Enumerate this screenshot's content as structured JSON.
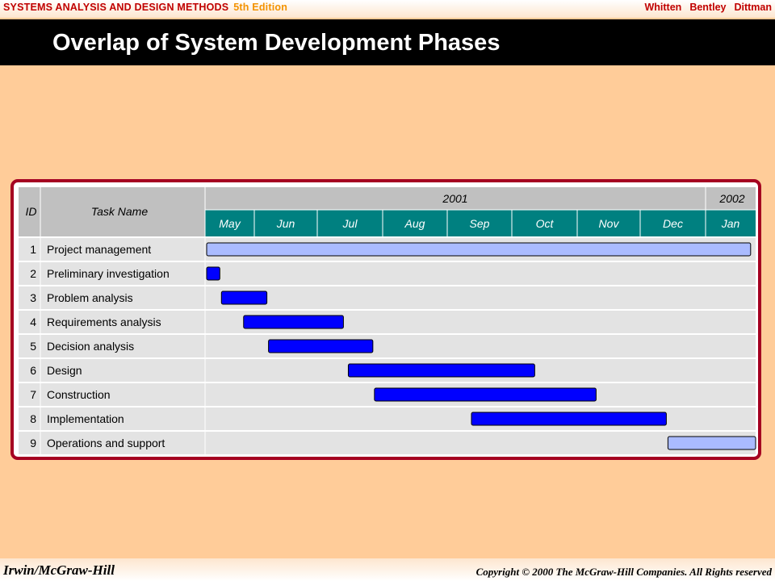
{
  "header": {
    "book_title": "SYSTEMS ANALYSIS AND DESIGN METHODS",
    "edition": "5th Edition",
    "authors": [
      "Whitten",
      "Bentley",
      "Dittman"
    ]
  },
  "slide": {
    "title": "Overlap of System Development Phases"
  },
  "footer": {
    "publisher": "Irwin/McGraw-Hill",
    "copyright": "Copyright © 2000 The McGraw-Hill Companies. All Rights reserved"
  },
  "colors": {
    "background": "#ffcc99",
    "title_bar": "#000000",
    "frame_border": "#a50021",
    "header_gray": "#c0c0c0",
    "month_teal": "#008080",
    "row_gray": "#e3e3e3",
    "bar_dark": "#0000ff",
    "bar_light": "#aabbff"
  },
  "chart_data": {
    "type": "gantt",
    "headers": {
      "id": "ID",
      "task_name": "Task Name"
    },
    "years": [
      {
        "label": "2001",
        "start": 0,
        "end": 8
      },
      {
        "label": "2002",
        "start": 8,
        "end": 9
      }
    ],
    "months": [
      "May",
      "Jun",
      "Jul",
      "Aug",
      "Sep",
      "Oct",
      "Nov",
      "Dec",
      "Jan"
    ],
    "tasks": [
      {
        "id": "1",
        "name": "Project management",
        "start": 0.0,
        "end": 8.9,
        "style": "light"
      },
      {
        "id": "2",
        "name": "Preliminary investigation",
        "start": 0.0,
        "end": 0.3,
        "style": "dark"
      },
      {
        "id": "3",
        "name": "Problem analysis",
        "start": 0.3,
        "end": 1.2,
        "style": "dark"
      },
      {
        "id": "4",
        "name": "Requirements analysis",
        "start": 0.75,
        "end": 2.4,
        "style": "dark"
      },
      {
        "id": "5",
        "name": "Decision analysis",
        "start": 1.2,
        "end": 2.85,
        "style": "dark"
      },
      {
        "id": "6",
        "name": "Design",
        "start": 2.45,
        "end": 5.35,
        "style": "dark"
      },
      {
        "id": "7",
        "name": "Construction",
        "start": 2.85,
        "end": 6.3,
        "style": "dark"
      },
      {
        "id": "8",
        "name": "Implementation",
        "start": 4.35,
        "end": 7.4,
        "style": "dark"
      },
      {
        "id": "9",
        "name": "Operations and support",
        "start": 7.4,
        "end": 9.0,
        "style": "light"
      }
    ]
  }
}
